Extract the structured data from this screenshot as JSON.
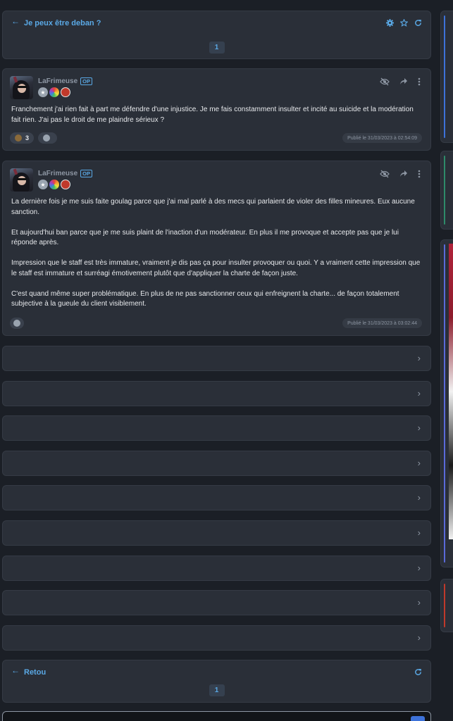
{
  "topic": {
    "title": "Je peux être deban ?",
    "page": "1",
    "icons": [
      "gear-icon",
      "star-icon",
      "refresh-icon"
    ]
  },
  "posts": [
    {
      "author": "LaFrimeuse",
      "op_label": "OP",
      "paragraphs": [
        "Franchement j'ai rien fait à part me défendre d'une injustice. Je me fais constamment insulter et incité au suicide et la modération fait rien. J'ai pas le droit de me plaindre sérieux ?"
      ],
      "reactions": [
        {
          "emoji": "poop-emoji",
          "count": "3"
        },
        {
          "emoji": "add-reaction-emoji",
          "count": ""
        }
      ],
      "timestamp": "Publié le 31/03/2023 à 02:54:09"
    },
    {
      "author": "LaFrimeuse",
      "op_label": "OP",
      "paragraphs": [
        "La dernière fois je me suis faite goulag parce que j'ai mal parlé à des mecs qui parlaient de violer des filles mineures. Eux aucune sanction.",
        "Et aujourd'hui ban parce que je me suis plaint de l'inaction d'un modérateur. En plus il me provoque et accepte pas que je lui réponde après.",
        "Impression que le staff est très immature, vraiment je dis pas ça pour insulter provoquer ou quoi. Y a vraiment cette impression que le staff est immature et surréagi émotivement plutôt que d'appliquer la charte de façon juste.",
        "C'est quand même super problématique. En plus de ne pas sanctionner ceux qui enfreignent la charte... de façon totalement subjective à la gueule du client visiblement."
      ],
      "reactions": [
        {
          "emoji": "add-reaction-emoji",
          "count": ""
        }
      ],
      "timestamp": "Publié le 31/03/2023 à 03:02:44"
    }
  ],
  "bottom_bar": {
    "back_label": "Retou",
    "page": "1"
  },
  "colors": {
    "background": "#1b1f26",
    "card": "#2a2f38",
    "accent": "#5aa9e6",
    "muted": "#8d96a3"
  }
}
